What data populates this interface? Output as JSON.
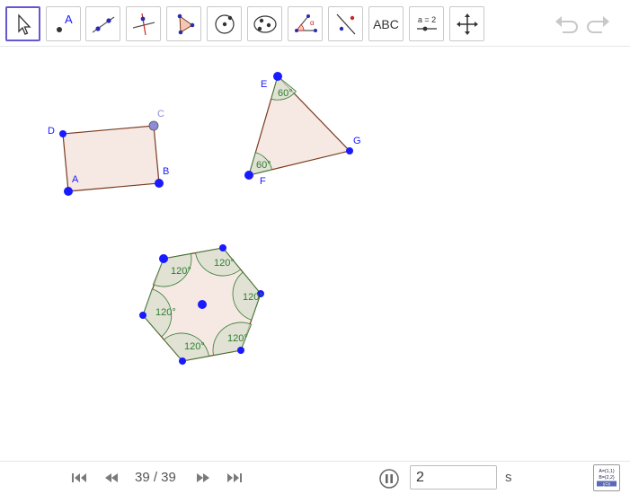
{
  "toolbar": {
    "tools": [
      {
        "name": "move-tool",
        "label": ""
      },
      {
        "name": "point-tool",
        "label": "A"
      },
      {
        "name": "line-tool",
        "label": ""
      },
      {
        "name": "perpendicular-tool",
        "label": ""
      },
      {
        "name": "polygon-tool",
        "label": ""
      },
      {
        "name": "circle-tool",
        "label": ""
      },
      {
        "name": "ellipse-tool",
        "label": ""
      },
      {
        "name": "angle-tool",
        "label": ""
      },
      {
        "name": "reflect-tool",
        "label": ""
      },
      {
        "name": "text-tool",
        "label": "ABC"
      },
      {
        "name": "slider-tool",
        "label": "a = 2"
      },
      {
        "name": "move-graphics-tool",
        "label": ""
      }
    ],
    "undo_icon": "undo-icon",
    "redo_icon": "redo-icon"
  },
  "canvas": {
    "quadrilateral": {
      "labels": {
        "A": "A",
        "B": "B",
        "C": "C",
        "D": "D"
      }
    },
    "triangle": {
      "labels": {
        "E": "E",
        "F": "F",
        "G": "G"
      },
      "angles": [
        "60°",
        "60°"
      ]
    },
    "hexagon": {
      "angles": [
        "120°",
        "120°",
        "120°",
        "120°",
        "120°",
        "120°"
      ]
    },
    "colors": {
      "point": "#1a1aff",
      "point_light": "#8c8cd9",
      "polygon_fill": "#f6e8e2",
      "polygon_stroke": "#7a3b20",
      "angle_fill": "#d9dfcf",
      "angle_stroke": "#2e7d32",
      "angle_text": "#2e7d32",
      "label": "#1a1aff"
    }
  },
  "bottombar": {
    "counter": "39 / 39",
    "speed_value": "2",
    "unit": "s",
    "algebra_icon_lines": [
      "A=(1,1)",
      "B=(2,2)",
      "y=x"
    ]
  }
}
